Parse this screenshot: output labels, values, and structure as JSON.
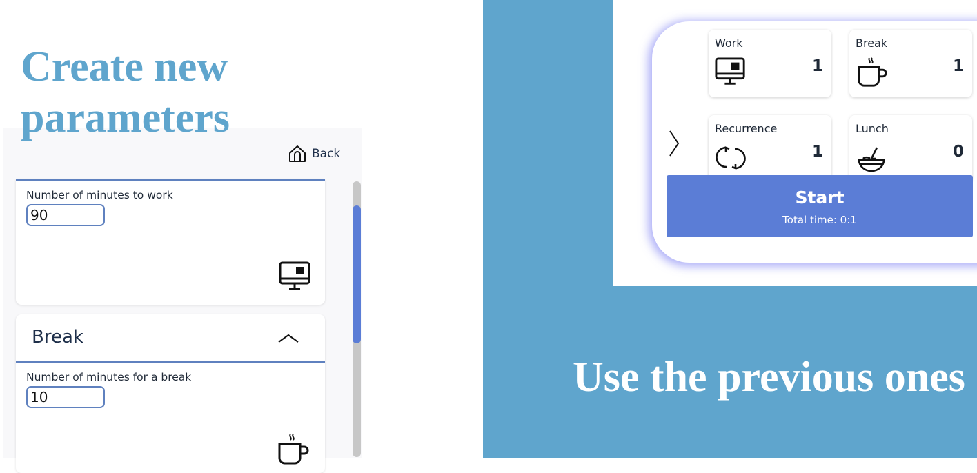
{
  "left": {
    "title_line1": "Create new",
    "title_line2": "parameters",
    "back_label": "Back",
    "work": {
      "label": "Number of minutes to work",
      "value": "90",
      "icon": "computer-monitor-icon"
    },
    "break": {
      "header": "Break",
      "label": "Number of minutes for a break",
      "value": "10",
      "icon": "coffee-cup-icon"
    }
  },
  "right": {
    "title": "Use the previous ones",
    "tiles": [
      {
        "label": "Work",
        "value": "1",
        "icon": "computer-monitor-icon"
      },
      {
        "label": "Break",
        "value": "1",
        "icon": "coffee-cup-icon"
      },
      {
        "label": "Recurrence",
        "value": "1",
        "icon": "refresh-icon"
      },
      {
        "label": "Lunch",
        "value": "0",
        "icon": "bowl-icon"
      }
    ],
    "start_label": "Start",
    "total_time": "Total time: 0:1"
  },
  "colors": {
    "title_blue": "#5fa5cd",
    "accent": "#5b7dd6",
    "input_border": "#5f81bf",
    "right_background": "#5fa5cd"
  }
}
